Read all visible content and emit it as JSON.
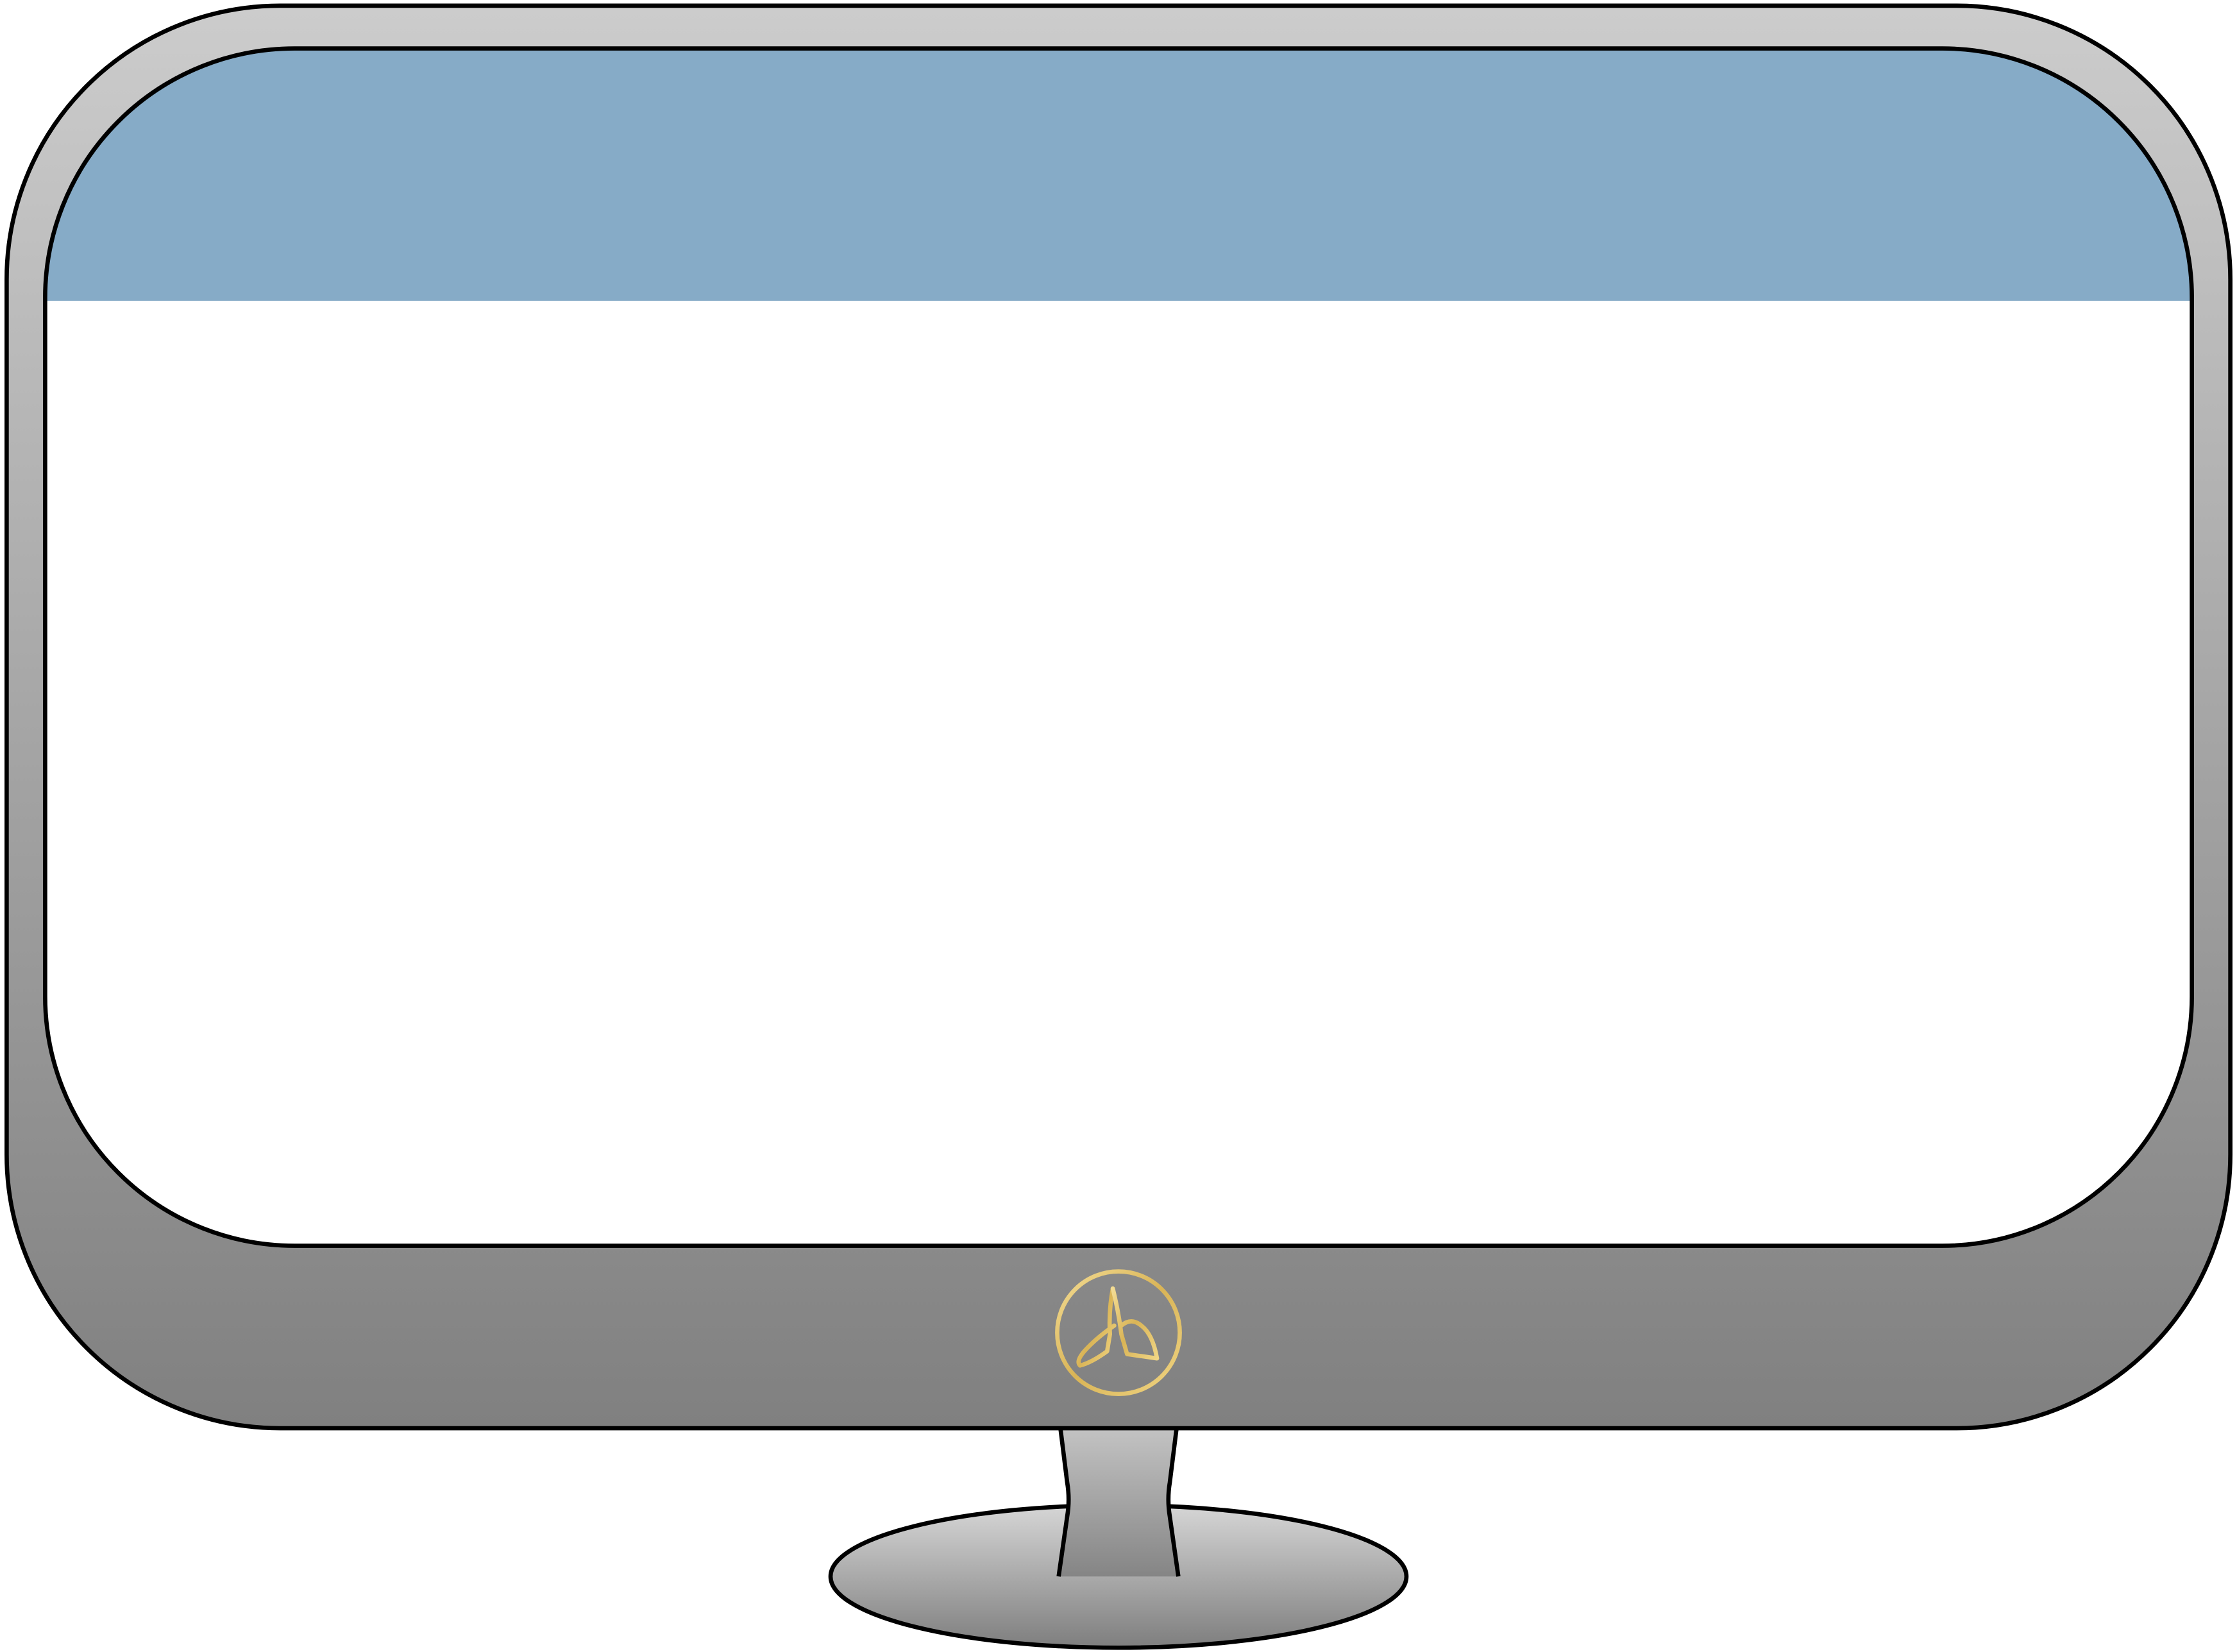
{
  "monitor": {
    "screen": {
      "header_color": "#86abc7",
      "body_color": "#ffffff"
    },
    "bezel": {
      "gradient_top": "#cccccc",
      "gradient_bottom": "#808080",
      "outline_color": "#000000"
    },
    "logo": {
      "icon": "gold-monogram-logo-icon",
      "color": "#e6c36a"
    },
    "stand": {
      "gradient_top": "#cccccc",
      "gradient_bottom": "#808080"
    }
  }
}
